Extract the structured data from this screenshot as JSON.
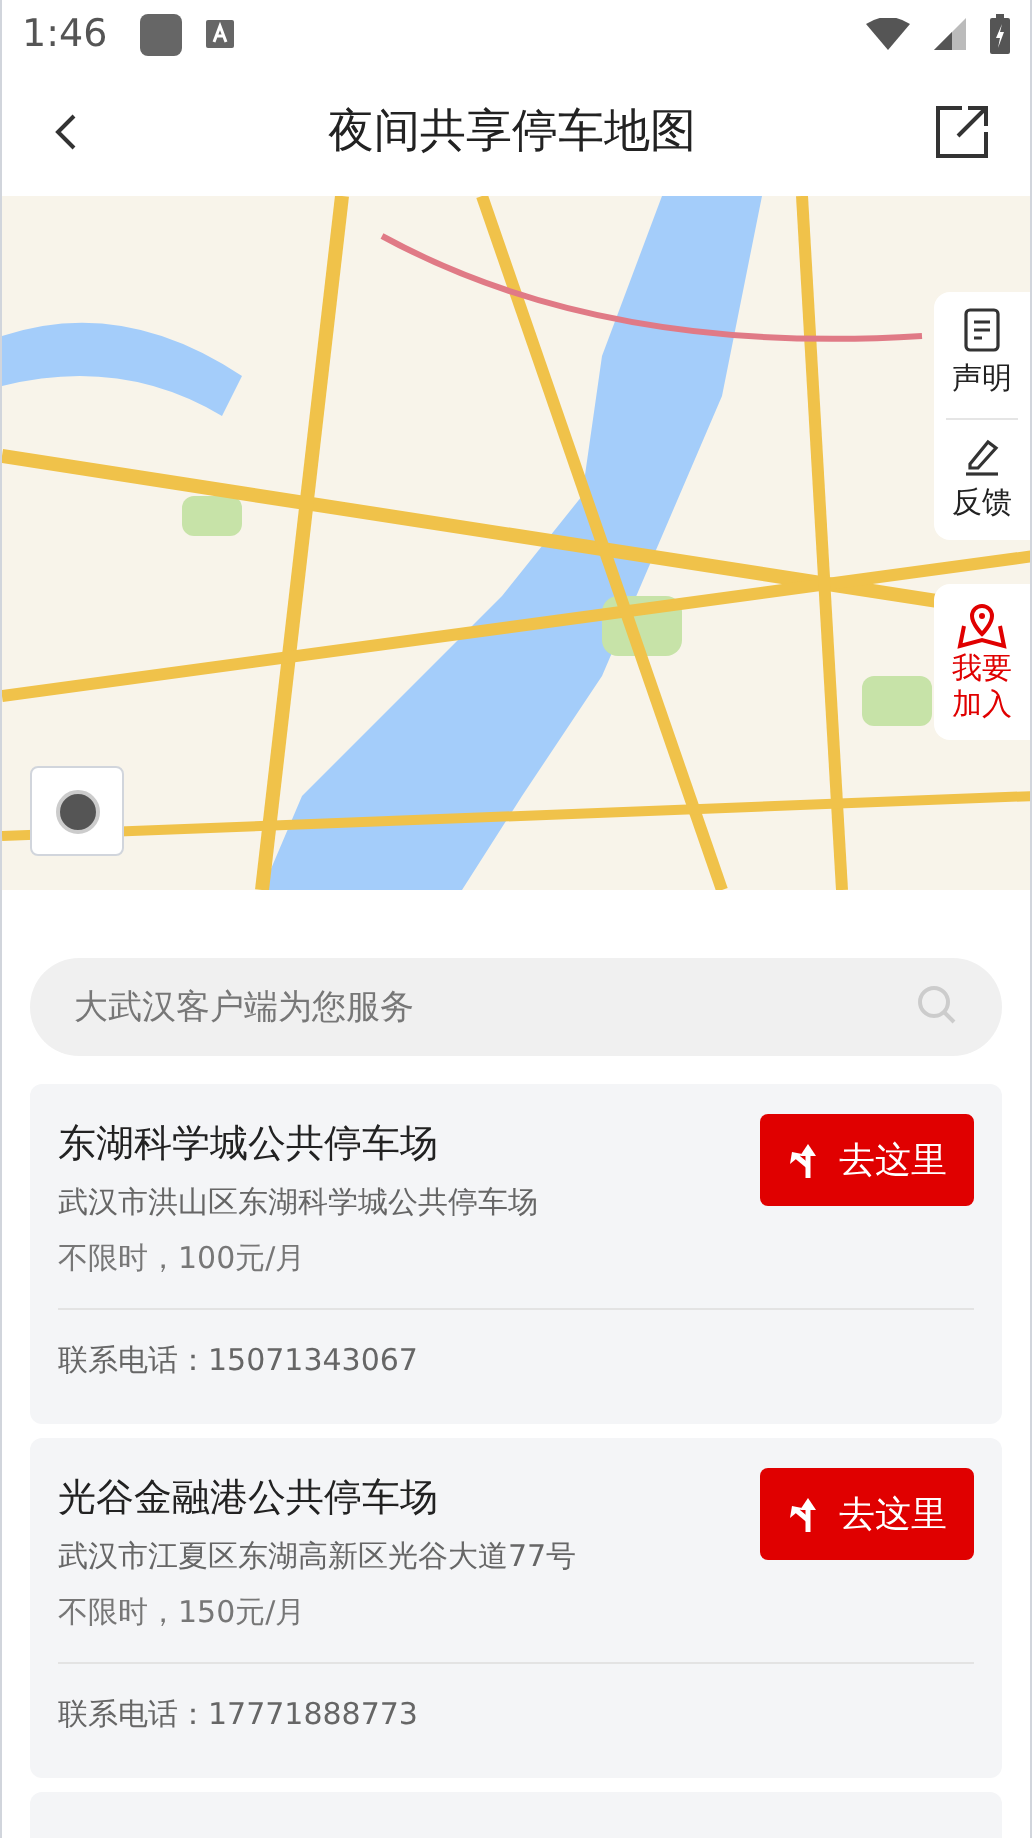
{
  "status_bar": {
    "time": "1:46"
  },
  "header": {
    "title": "夜间共享停车地图"
  },
  "map": {
    "side_buttons": [
      {
        "label": "声明",
        "kind": "notice"
      },
      {
        "label": "反馈",
        "kind": "feedback"
      }
    ],
    "join_button": {
      "label": "我要加入"
    }
  },
  "search": {
    "placeholder": "大武汉客户端为您服务"
  },
  "lots": [
    {
      "name": "东湖科学城公共停车场",
      "address": "武汉市洪山区东湖科学城公共停车场",
      "price": "不限时，100元/月",
      "phone": "联系电话：15071343067",
      "button": "去这里"
    },
    {
      "name": "光谷金融港公共停车场",
      "address": "武汉市江夏区东湖高新区光谷大道77号",
      "price": "不限时，150元/月",
      "phone": "联系电话：17771888773",
      "button": "去这里"
    }
  ]
}
